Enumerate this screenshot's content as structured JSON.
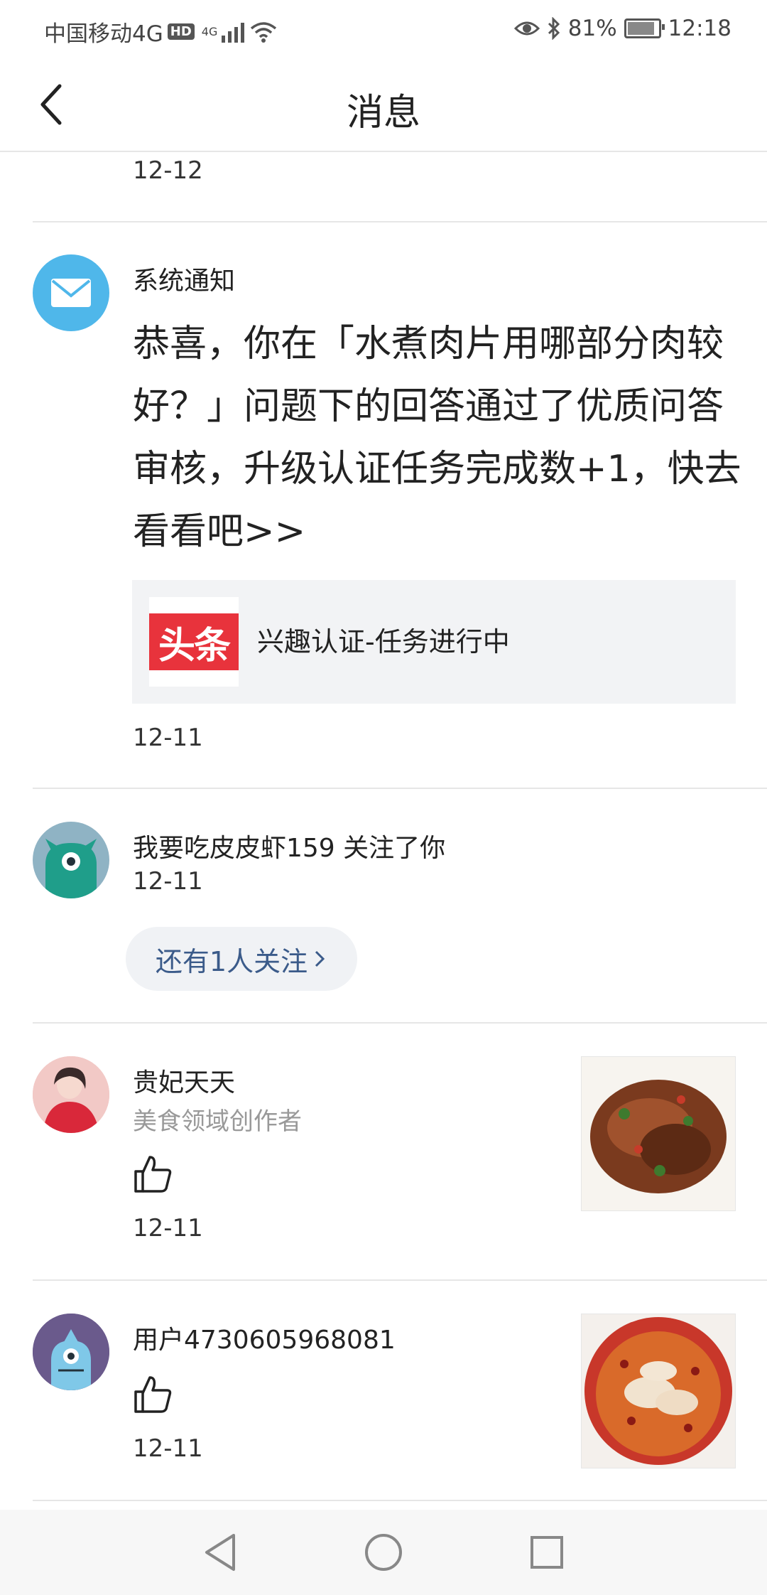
{
  "status_bar": {
    "carrier": "中国移动4G",
    "hd": "HD",
    "net": "4G",
    "battery_percent": "81%",
    "battery_level": 0.81,
    "time": "12:18"
  },
  "header": {
    "title": "消息"
  },
  "top_item": {
    "date": "12-12"
  },
  "system_notice": {
    "title": "系统通知",
    "body": "恭喜，你在「水煮肉片用哪部分肉较好？」问题下的回答通过了优质问答审核，升级认证任务完成数+1，快去看看吧>>",
    "card_logo": "头条",
    "card_text": "兴趣认证-任务进行中",
    "date": "12-11"
  },
  "follow_item": {
    "text": "我要吃皮皮虾159 关注了你",
    "date": "12-11",
    "more_button": "还有1人关注"
  },
  "like_items": [
    {
      "name": "贵妃天天",
      "subtitle": "美食领域创作者",
      "date": "12-11"
    },
    {
      "name": "用户4730605968081",
      "date": "12-11"
    }
  ],
  "colors": {
    "accent_blue": "#3b5b8a",
    "mail_icon_bg": "#4fb7ea",
    "logo_red": "#e8333c"
  }
}
